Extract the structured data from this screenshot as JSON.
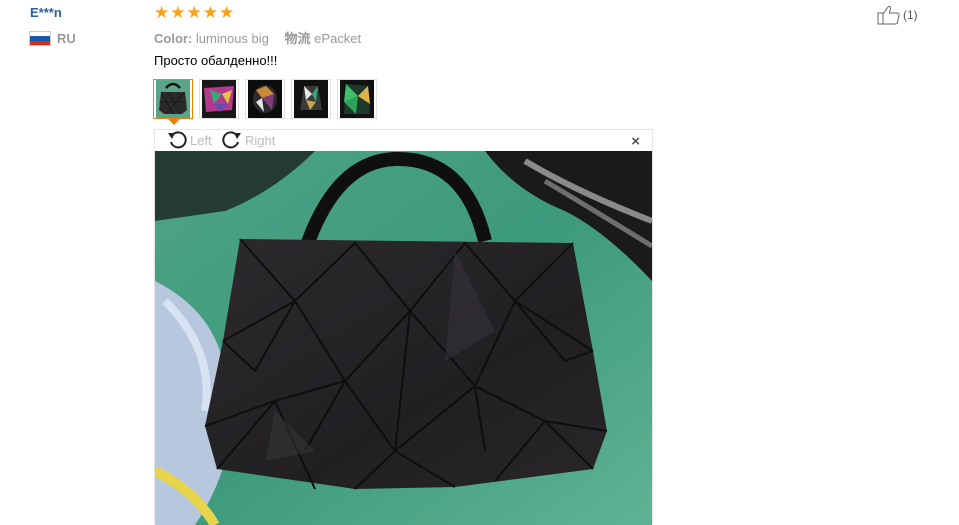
{
  "review": {
    "user": {
      "name": "E***n",
      "country": "RU"
    },
    "rating": {
      "stars": 5
    },
    "meta": {
      "color_label": "Color:",
      "color_value": "luminous big",
      "shipping_label": "物流",
      "shipping_value": "ePacket"
    },
    "text": "Просто обалденно!!!",
    "helpful": {
      "count": "(1)"
    },
    "thumbnails": [
      {
        "alt": "photo-1",
        "active": true
      },
      {
        "alt": "photo-2",
        "active": false
      },
      {
        "alt": "photo-3",
        "active": false
      },
      {
        "alt": "photo-4",
        "active": false
      },
      {
        "alt": "photo-5",
        "active": false
      }
    ],
    "viewer": {
      "rotate_left_label": "Left",
      "rotate_right_label": "Right",
      "close_symbol": "×"
    }
  },
  "colors": {
    "username": "#2d5e9e",
    "star": "#f9a21a",
    "active_border": "#f08000"
  },
  "icons": [
    "thumbs-up-icon",
    "rotate-left-icon",
    "rotate-right-icon",
    "close-icon",
    "star-icon",
    "flag-ru-icon"
  ]
}
